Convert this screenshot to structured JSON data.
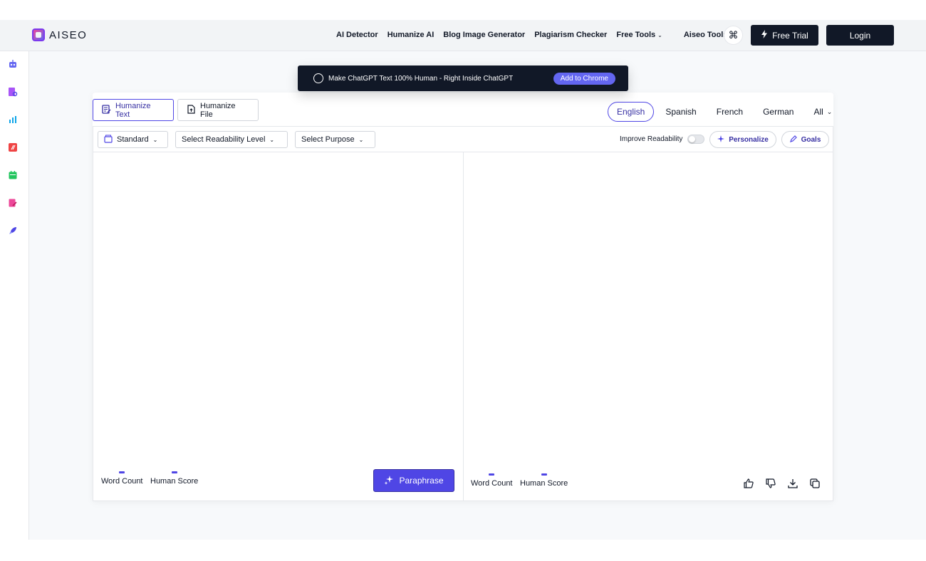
{
  "brand": {
    "name": "AISEO"
  },
  "nav": {
    "links": [
      "AI Detector",
      "Humanize AI",
      "Blog Image Generator",
      "Plagiarism Checker"
    ],
    "dropdowns": [
      "Free Tools",
      "Aiseo Tools"
    ],
    "cmd_symbol": "⌘",
    "free_trial": "Free Trial",
    "login": "Login"
  },
  "banner": {
    "text": "Make ChatGPT Text 100% Human - Right Inside ChatGPT",
    "button": "Add to Chrome"
  },
  "tabs": {
    "humanize_text": "Humanize Text",
    "humanize_file": "Humanize File"
  },
  "languages": {
    "items": [
      "English",
      "Spanish",
      "French",
      "German"
    ],
    "all": "All",
    "selected": "English"
  },
  "toolbar": {
    "mode": "Standard",
    "readability": "Select Readability Level",
    "purpose": "Select Purpose",
    "improve_readability": "Improve Readability",
    "personalize": "Personalize",
    "goals": "Goals"
  },
  "left_panel": {
    "word_count_label": "Word Count",
    "human_score_label": "Human Score",
    "paraphrase": "Paraphrase"
  },
  "right_panel": {
    "word_count_label": "Word Count",
    "human_score_label": "Human Score"
  },
  "colors": {
    "accent": "#4f46e5",
    "dark": "#111827"
  },
  "sidebar_icons": [
    "robot-icon",
    "document-search-icon",
    "chart-icon",
    "slash-icon",
    "calendar-icon",
    "edit-document-icon",
    "rocket-icon"
  ]
}
